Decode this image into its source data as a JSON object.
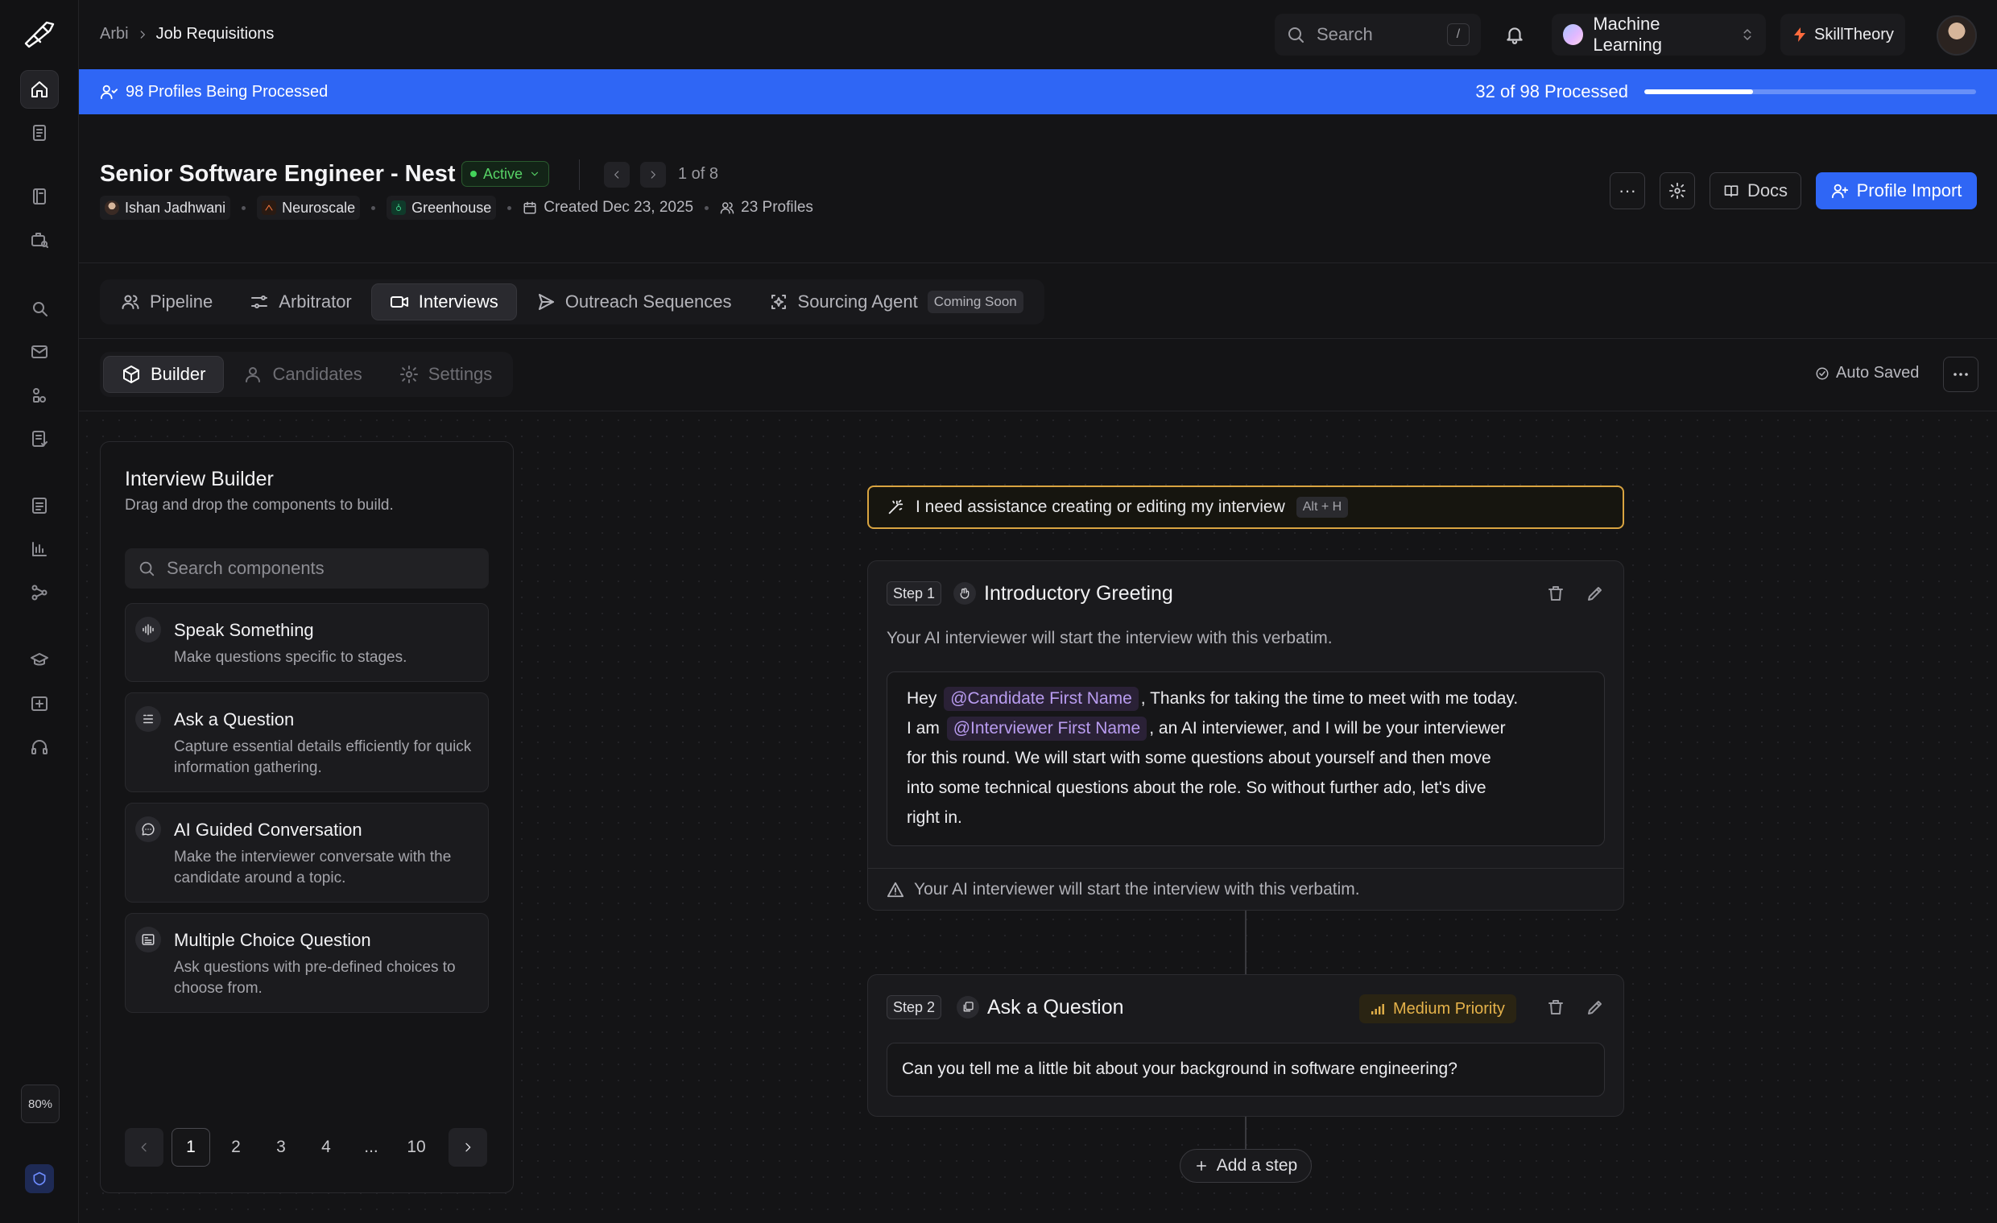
{
  "breadcrumb": {
    "root": "Arbi",
    "current": "Job Requisitions"
  },
  "search": {
    "placeholder": "Search",
    "shortcut": "/"
  },
  "workspace": {
    "name": "Machine Learning"
  },
  "org": {
    "name": "SkillTheory"
  },
  "banner": {
    "text": "98 Profiles Being Processed",
    "progress_text": "32 of 98 Processed",
    "processed": 32,
    "total": 98,
    "color": "#2f66f5"
  },
  "job": {
    "title": "Senior Software Engineer - Nest",
    "status": "Active",
    "pager": "1 of 8",
    "owner": "Ishan Jadhwani",
    "company": "Neuroscale",
    "ats": "Greenhouse",
    "created": "Created Dec 23, 2025",
    "profiles": "23 Profiles"
  },
  "header_actions": {
    "more": "···",
    "docs": "Docs",
    "import": "Profile Import"
  },
  "tabs": [
    {
      "label": "Pipeline",
      "icon": "users-icon"
    },
    {
      "label": "Arbitrator",
      "icon": "sliders-icon"
    },
    {
      "label": "Interviews",
      "icon": "video-icon",
      "active": true
    },
    {
      "label": "Outreach Sequences",
      "icon": "send-icon"
    },
    {
      "label": "Sourcing Agent",
      "icon": "sparkle-icon",
      "badge": "Coming Soon"
    }
  ],
  "subtabs": [
    {
      "label": "Builder",
      "active": true
    },
    {
      "label": "Candidates"
    },
    {
      "label": "Settings"
    }
  ],
  "autosave": "Auto Saved",
  "builder": {
    "title": "Interview Builder",
    "subtitle": "Drag and drop the components to build.",
    "search_placeholder": "Search components",
    "components": [
      {
        "title": "Speak Something",
        "desc": "Make questions specific to stages.",
        "icon": "audio-wave-icon"
      },
      {
        "title": "Ask a Question",
        "desc": "Capture essential details efficiently for quick information gathering.",
        "icon": "list-icon"
      },
      {
        "title": "AI Guided Conversation",
        "desc": "Make the interviewer conversate with the candidate around a topic.",
        "icon": "chat-icon"
      },
      {
        "title": "Multiple Choice Question",
        "desc": "Ask questions with pre-defined choices to choose from.",
        "icon": "choice-icon"
      }
    ],
    "pagination": [
      "1",
      "2",
      "3",
      "4",
      "...",
      "10"
    ],
    "current_page": "1"
  },
  "assist": {
    "text": "I need assistance creating or editing my interview",
    "shortcut": "Alt + H"
  },
  "steps": [
    {
      "tag": "Step 1",
      "title": "Introductory Greeting",
      "desc": "Your AI interviewer will start the interview with this verbatim.",
      "msg_a": "Hey",
      "mention_a": "@Candidate First Name",
      "msg_b": ", Thanks for taking the time to meet with me today. I am",
      "mention_b": "@Interviewer First Name",
      "msg_c": ", an AI interviewer, and I will be your interviewer for this round. We will start with some questions about yourself and then move into some technical questions about the role. So without further ado, let's dive right in.",
      "footer": "Your AI interviewer will start the interview with this verbatim."
    },
    {
      "tag": "Step 2",
      "title": "Ask a Question",
      "priority": "Medium Priority",
      "question": "Can you tell me a little bit about your background in software engineering?"
    }
  ],
  "add_step": "Add a step",
  "zoom": "80%",
  "colors": {
    "accent": "#2f66f5",
    "active_green": "#43d35a",
    "assist_border": "#d9a441",
    "priority": "#e5b24a",
    "mention": "#b99cf0"
  }
}
